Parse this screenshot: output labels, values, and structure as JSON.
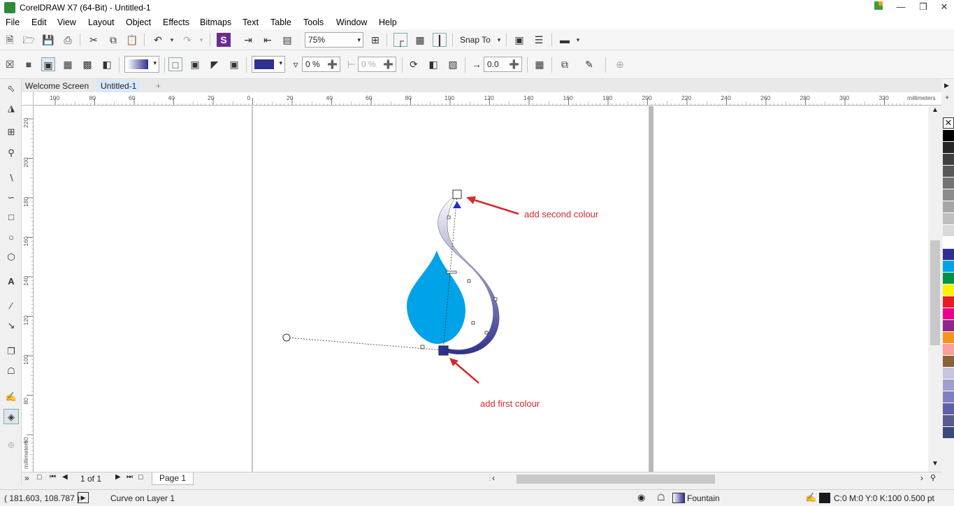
{
  "window": {
    "title": "CorelDRAW X7 (64-Bit) - Untitled-1"
  },
  "menu": [
    "File",
    "Edit",
    "View",
    "Layout",
    "Object",
    "Effects",
    "Bitmaps",
    "Text",
    "Table",
    "Tools",
    "Window",
    "Help"
  ],
  "standard_toolbar": {
    "zoom_value": "75%",
    "snap_to_label": "Snap To"
  },
  "property_bar": {
    "fill_color": "#2e3191",
    "transparency_value": "0 %",
    "node_transparency_value": "0 %",
    "angle_value": "0.0"
  },
  "tabs": [
    "Welcome Screen",
    "Untitled-1"
  ],
  "rulers": {
    "horizontal_ticks": [
      "100",
      "80",
      "60",
      "40",
      "20",
      "0",
      "20",
      "40",
      "60",
      "80",
      "100",
      "120",
      "140",
      "160",
      "180",
      "200",
      "220",
      "240",
      "260",
      "280",
      "300",
      "320"
    ],
    "vertical_ticks": [
      "220",
      "200",
      "180",
      "160",
      "140",
      "120",
      "100",
      "80",
      "60"
    ],
    "unit_label": "millimeters"
  },
  "annotations": {
    "second_colour": "add second colour",
    "first_colour": "add first colour"
  },
  "page_nav": {
    "counter": "1 of 1",
    "page_tab": "Page 1"
  },
  "status": {
    "coordinates": "( 181.603, 108.787 )",
    "object_info": "Curve on Layer 1",
    "fill_type": "Fountain",
    "outline_info": "C:0 M:0 Y:0 K:100  0.500 pt"
  },
  "colors": {
    "drop": "#00a3e8",
    "gradient_start": "#2e3191",
    "gradient_end": "#ffffff",
    "annotation": "#d42a2a"
  },
  "palette": [
    "#000000",
    "#262626",
    "#404040",
    "#595959",
    "#737373",
    "#8c8c8c",
    "#a6a6a6",
    "#bfbfbf",
    "#d9d9d9",
    "#ffffff",
    "#2e3191",
    "#00a3e8",
    "#009245",
    "#fff200",
    "#ed1c24",
    "#ec008c",
    "#92278f",
    "#f7941d",
    "#f9a19a",
    "#8c6239",
    "#c5c5e0",
    "#a0a0d0",
    "#8080c0",
    "#6060a8",
    "#5b5b8c",
    "#3c4a7a"
  ]
}
